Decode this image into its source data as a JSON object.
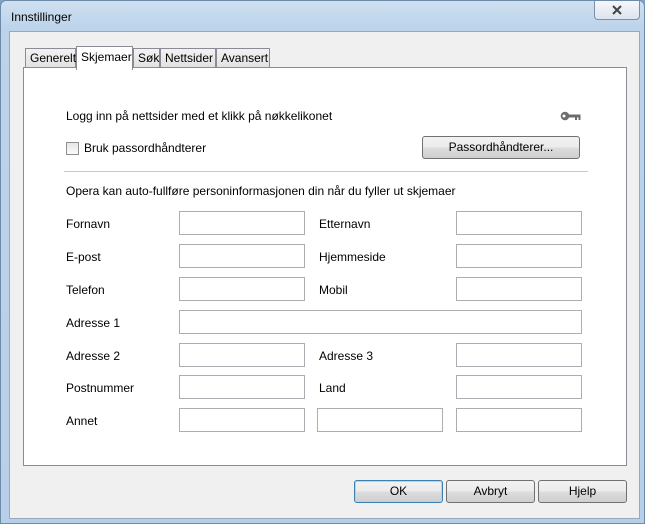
{
  "window": {
    "title": "Innstillinger"
  },
  "tabs": [
    "Generelt",
    "Skjemaer",
    "Søk",
    "Nettsider",
    "Avansert"
  ],
  "active_tab": "Skjemaer",
  "passwords": {
    "intro": "Logg inn på nettsider med et klikk på nøkkelikonet",
    "checkbox_label": "Bruk passordhåndterer",
    "checkbox_checked": false,
    "button_label": "Passordhåndterer..."
  },
  "autofill": {
    "intro": "Opera kan auto-fullføre personinformasjonen din når du fyller ut skjemaer",
    "fields": {
      "first_name": {
        "label": "Fornavn",
        "value": ""
      },
      "last_name": {
        "label": "Etternavn",
        "value": ""
      },
      "email": {
        "label": "E-post",
        "value": ""
      },
      "homepage": {
        "label": "Hjemmeside",
        "value": ""
      },
      "phone": {
        "label": "Telefon",
        "value": ""
      },
      "mobile": {
        "label": "Mobil",
        "value": ""
      },
      "address1": {
        "label": "Adresse 1",
        "value": ""
      },
      "address2": {
        "label": "Adresse 2",
        "value": ""
      },
      "address3": {
        "label": "Adresse 3",
        "value": ""
      },
      "postcode": {
        "label": "Postnummer",
        "value": ""
      },
      "country": {
        "label": "Land",
        "value": ""
      },
      "other": {
        "label": "Annet",
        "values": [
          "",
          "",
          ""
        ]
      }
    }
  },
  "footer": {
    "ok": "OK",
    "cancel": "Avbryt",
    "help": "Hjelp"
  }
}
